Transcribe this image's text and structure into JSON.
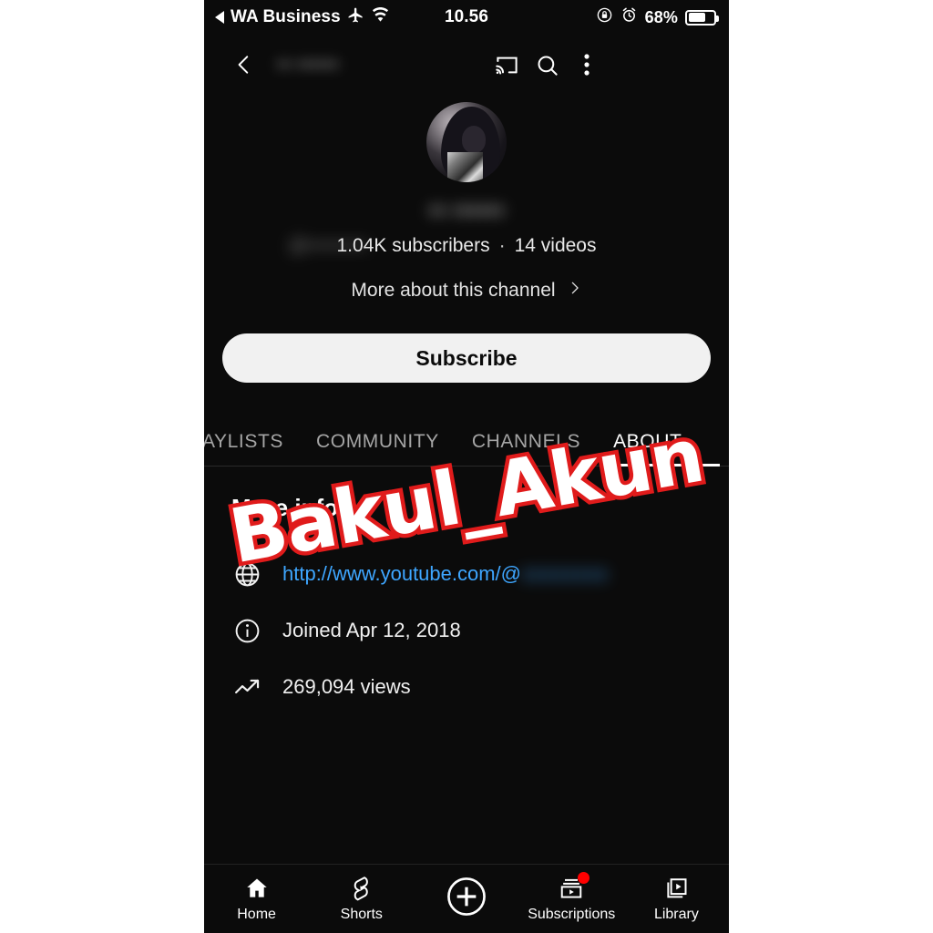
{
  "status_bar": {
    "back_app": "WA Business",
    "airplane_icon": "airplane-icon",
    "wifi_icon": "wifi-icon",
    "time": "10.56",
    "rotation_lock_icon": "rotation-lock-icon",
    "alarm_icon": "alarm-icon",
    "battery_percent": "68%"
  },
  "app_bar": {
    "back_icon": "back-chevron-icon",
    "channel_title": "•• ••••••",
    "cast_icon": "cast-icon",
    "search_icon": "search-icon",
    "overflow_icon": "more-vertical-icon"
  },
  "channel": {
    "avatar_alt": "channel-avatar",
    "name": "•• ••••••",
    "handle": "@•••••••••",
    "subscribers": "1.04K subscribers",
    "separator": "·",
    "videos": "14 videos",
    "more_about": "More about this channel",
    "more_about_chevron": "chevron-right-icon",
    "subscribe_label": "Subscribe"
  },
  "tabs": [
    {
      "label": "AYLISTS",
      "active": false
    },
    {
      "label": "COMMUNITY",
      "active": false
    },
    {
      "label": "CHANNELS",
      "active": false
    },
    {
      "label": "ABOUT",
      "active": true
    }
  ],
  "about": {
    "heading": "More info",
    "rows": [
      {
        "icon": "globe-icon",
        "text": "http://www.youtube.com/@",
        "blurred_suffix": "xxxxxxxx",
        "is_link": true
      },
      {
        "icon": "info-circle-icon",
        "text": "Joined Apr 12, 2018",
        "is_link": false
      },
      {
        "icon": "trending-up-icon",
        "text": "269,094 views",
        "is_link": false
      }
    ]
  },
  "watermark": {
    "text": "Bakul_Akun",
    "fill_color": "#ffffff",
    "stroke_color": "#e01b1b"
  },
  "bottom_nav": [
    {
      "label": "Home",
      "icon": "home-icon",
      "badge": false
    },
    {
      "label": "Shorts",
      "icon": "shorts-icon",
      "badge": false
    },
    {
      "label": "",
      "icon": "create-plus-icon",
      "badge": false
    },
    {
      "label": "Subscriptions",
      "icon": "subscriptions-icon",
      "badge": true
    },
    {
      "label": "Library",
      "icon": "library-icon",
      "badge": false
    }
  ],
  "colors": {
    "background": "#0b0b0b",
    "link": "#3ea6ff",
    "accent_red": "#ff0000",
    "subscribe_bg": "#f1f1f1"
  }
}
